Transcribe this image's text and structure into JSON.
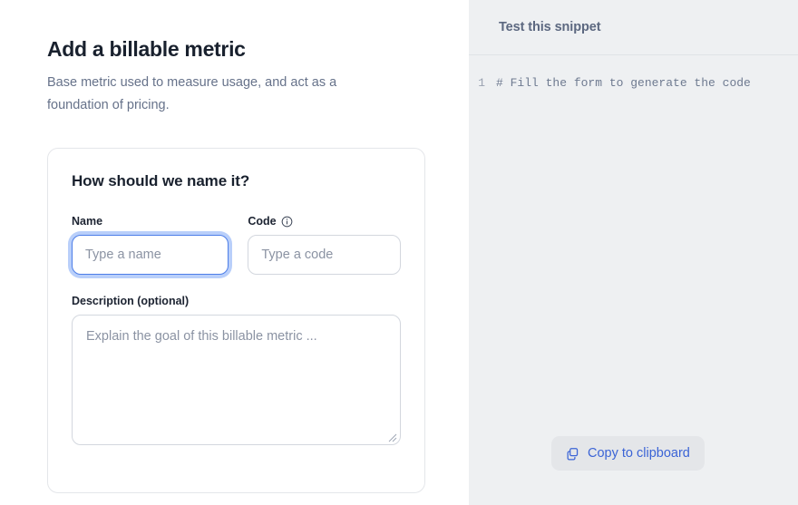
{
  "form_pane": {
    "page_title": "Add a billable metric",
    "page_subtitle": "Base metric used to measure usage, and act as a foundation of pricing.",
    "card": {
      "title": "How should we name it?",
      "name_field": {
        "label": "Name",
        "placeholder": "Type a name",
        "value": ""
      },
      "code_field": {
        "label": "Code",
        "info_icon": "info-circle-icon",
        "placeholder": "Type a code",
        "value": ""
      },
      "description_field": {
        "label": "Description (optional)",
        "placeholder": "Explain the goal of this billable metric ...",
        "value": ""
      }
    }
  },
  "code_pane": {
    "header_title": "Test this snippet",
    "code_lines": [
      {
        "number": "1",
        "text": "# Fill the form to generate the code"
      }
    ],
    "copy_button": {
      "label": "Copy to clipboard",
      "icon": "copy-icon"
    }
  },
  "colors": {
    "accent_blue": "#3b64d6",
    "focus_border": "#4d7ee8",
    "focus_ring": "#b9cffa",
    "heading": "#19212e",
    "muted_text": "#66728a",
    "code_pane_bg": "#eef0f2",
    "card_border": "#e4e6ea",
    "input_border": "#d3d7de"
  }
}
